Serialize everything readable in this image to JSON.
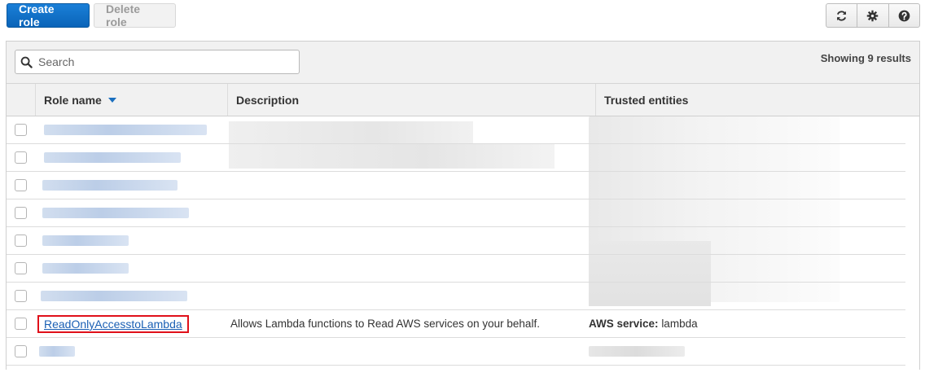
{
  "toolbar": {
    "create_label": "Create role",
    "delete_label": "Delete role",
    "icons": [
      "refresh-icon",
      "gear-icon",
      "help-icon"
    ]
  },
  "search": {
    "placeholder": "Search",
    "value": "",
    "results_text": "Showing 9 results"
  },
  "table": {
    "columns": [
      "Role name",
      "Description",
      "Trusted entities"
    ],
    "sort_column": "Role name",
    "highlighted_row": {
      "role_name": "ReadOnlyAccesstoLambda",
      "description": "Allows Lambda functions to Read AWS services on your behalf.",
      "trusted_label": "AWS service:",
      "trusted_value": "lambda"
    }
  },
  "colors": {
    "primary": "#0a64b8",
    "link": "#1a5fb4",
    "highlight_border": "#e0101a"
  }
}
